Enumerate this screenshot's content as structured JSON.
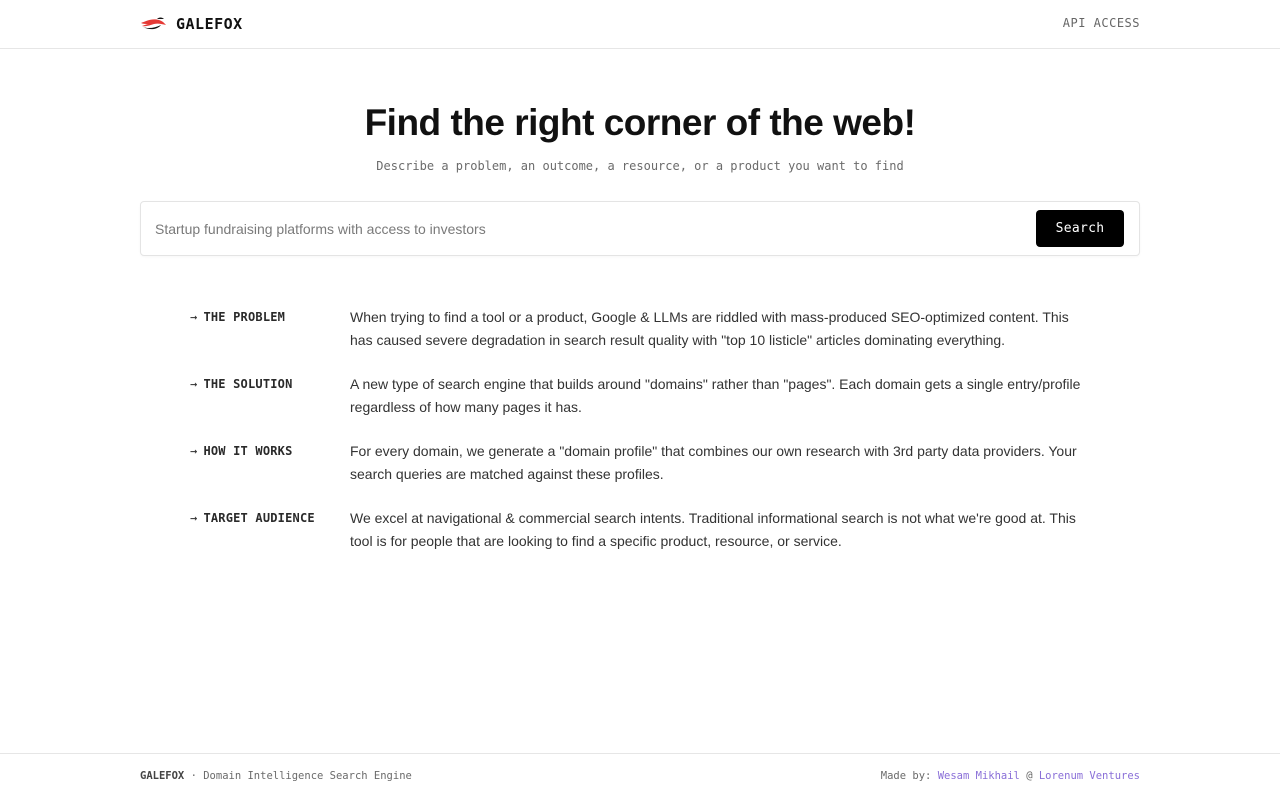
{
  "header": {
    "brand": "GALEFOX",
    "logo_icon": "fox-tail-logo-icon",
    "api_link": "API ACCESS"
  },
  "hero": {
    "title": "Find the right corner of the web!",
    "subtitle": "Describe a problem, an outcome, a resource, or a product you want to find"
  },
  "search": {
    "placeholder": "Startup fundraising platforms with access to investors",
    "value": "",
    "button_label": "Search"
  },
  "info": [
    {
      "label": "THE PROBLEM",
      "text": "When trying to find a tool or a product, Google & LLMs are riddled with mass-produced SEO-optimized content. This has caused severe degradation in search result quality with \"top 10 listicle\" articles dominating everything."
    },
    {
      "label": "THE SOLUTION",
      "text": "A new type of search engine that builds around \"domains\" rather than \"pages\". Each domain gets a single entry/profile regardless of how many pages it has."
    },
    {
      "label": "HOW IT WORKS",
      "text": "For every domain, we generate a \"domain profile\" that combines our own research with 3rd party data providers. Your search queries are matched against these profiles."
    },
    {
      "label": "TARGET AUDIENCE",
      "text": "We excel at navigational & commercial search intents. Traditional informational search is not what we're good at. This tool is for people that are looking to find a specific product, resource, or service."
    }
  ],
  "arrow_glyph": "→",
  "footer": {
    "brand": "GALEFOX",
    "separator": " · ",
    "tagline": "Domain Intelligence Search Engine",
    "made_by_prefix": "Made by: ",
    "author": "Wesam Mikhail",
    "at": " @ ",
    "company": "Lorenum Ventures"
  },
  "colors": {
    "accent_link": "#8a6fd8",
    "logo_red": "#e53935",
    "button_bg": "#000000"
  }
}
